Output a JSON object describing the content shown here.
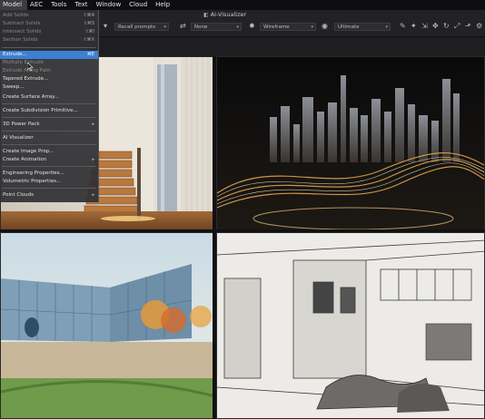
{
  "menubar": {
    "items": [
      "Model",
      "AEC",
      "Tools",
      "Text",
      "Window",
      "Cloud",
      "Help"
    ],
    "active_index": 0
  },
  "window": {
    "title": "AI-Visualizer"
  },
  "toolbar": {
    "prompt_select": "Recall prompts",
    "style_select": "None",
    "mode_select": "Wireframe",
    "view_select": "Ultimate"
  },
  "model_menu": {
    "items": [
      {
        "label": "Add Solids",
        "shortcut": "⇧⌘A",
        "state": "dim"
      },
      {
        "label": "Subtract Solids",
        "shortcut": "⇧⌘S",
        "state": "dim"
      },
      {
        "label": "Intersect Solids",
        "shortcut": "⇧⌘I",
        "state": "dim"
      },
      {
        "label": "Section Solids",
        "shortcut": "⇧⌘X",
        "state": "dim"
      },
      {
        "label": "Extrude...",
        "shortcut": "⌘E",
        "state": "highlighted"
      },
      {
        "label": "Multiple Extrude",
        "shortcut": "",
        "state": "dim"
      },
      {
        "label": "Extrude Along Path",
        "shortcut": "",
        "state": "dim"
      },
      {
        "label": "Tapered Extrude...",
        "shortcut": "",
        "state": "normal"
      },
      {
        "label": "Sweep...",
        "shortcut": "",
        "state": "normal"
      },
      {
        "label": "Create Surface Array...",
        "shortcut": "",
        "state": "normal"
      },
      {
        "label": "Create Subdivision Primitive...",
        "shortcut": "",
        "state": "normal"
      },
      {
        "label": "3D Power Pack",
        "shortcut": "",
        "state": "normal",
        "submenu": true
      },
      {
        "label": "AI Visualizer",
        "shortcut": "",
        "state": "normal"
      },
      {
        "label": "Create Image Prop...",
        "shortcut": "",
        "state": "normal"
      },
      {
        "label": "Create Animation",
        "shortcut": "",
        "state": "normal",
        "submenu": true
      },
      {
        "label": "Engineering Properties...",
        "shortcut": "",
        "state": "normal"
      },
      {
        "label": "Volumetric Properties...",
        "shortcut": "",
        "state": "normal"
      },
      {
        "label": "Point Clouds",
        "shortcut": "",
        "state": "normal",
        "submenu": true
      }
    ]
  },
  "render_panels": [
    {
      "name": "render-staircase-interior",
      "subject": "warm modern interior with wooden staircase"
    },
    {
      "name": "render-futuristic-city",
      "subject": "abstract city skyline with golden light waves"
    },
    {
      "name": "render-watercolor-campus",
      "subject": "watercolor campus building with autumn trees"
    },
    {
      "name": "render-sketch-interior",
      "subject": "pencil sketch of open-plan interior"
    }
  ],
  "colors": {
    "menu_highlight": "#3d7fd4",
    "background": "#1b1b1d",
    "gold_accent": "#e0a24c"
  }
}
